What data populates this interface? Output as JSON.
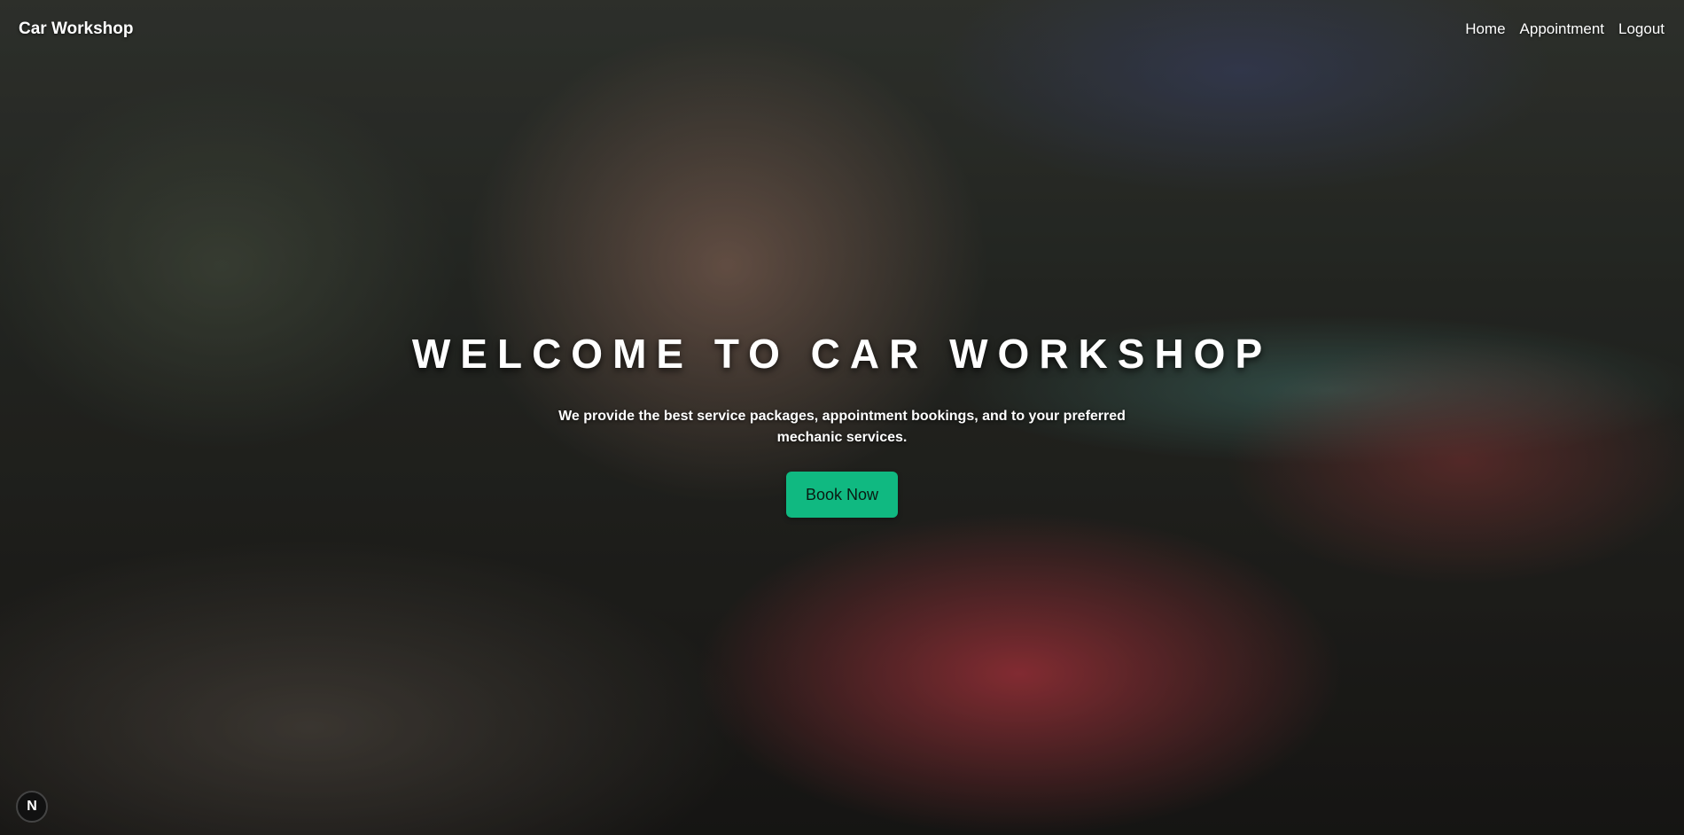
{
  "navbar": {
    "brand": "Car Workshop",
    "links": [
      {
        "label": "Home"
      },
      {
        "label": "Appointment"
      },
      {
        "label": "Logout"
      }
    ]
  },
  "hero": {
    "title": "WELCOME TO CAR WORKSHOP",
    "subtitle": "We provide the best service packages, appointment bookings, and to your preferred mechanic services.",
    "button_label": "Book Now",
    "button_color": "#10b981"
  },
  "badge": {
    "letter": "N",
    "icon": "nextjs-icon"
  }
}
